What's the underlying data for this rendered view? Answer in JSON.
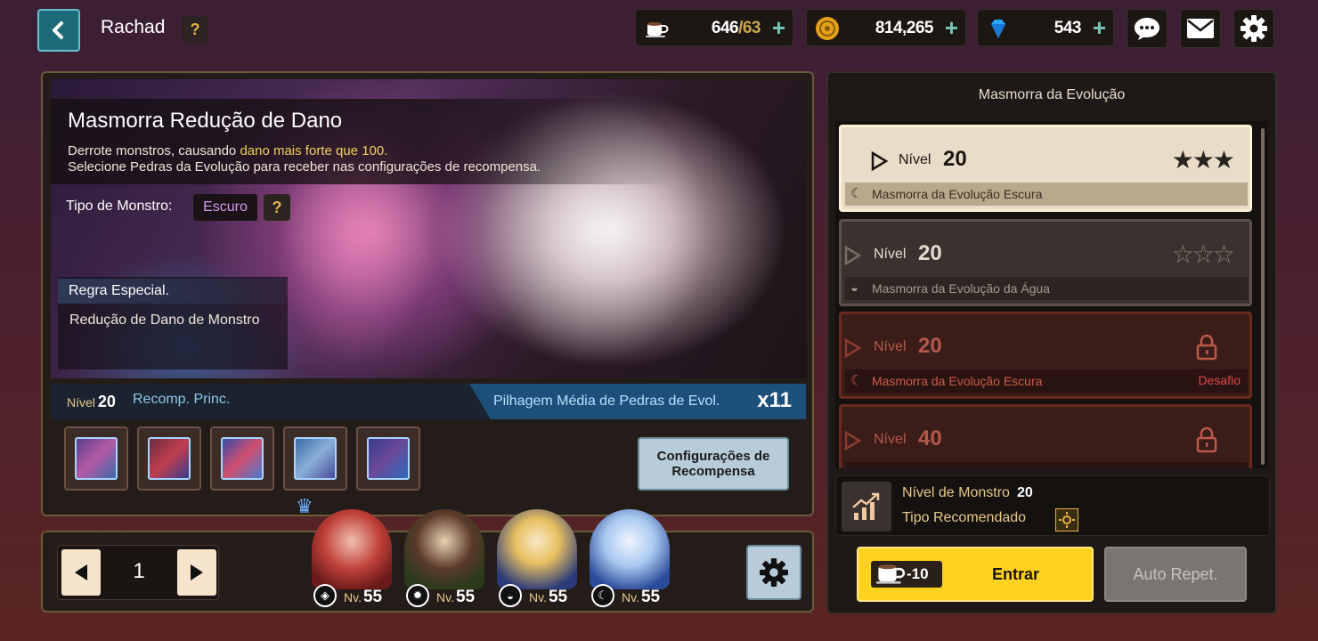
{
  "header": {
    "player_name": "Rachad",
    "help_label": "?",
    "stamina": {
      "current": "646",
      "max": "/63",
      "plus": "+"
    },
    "gold": {
      "value": "814,265",
      "plus": "+"
    },
    "gems": {
      "value": "543",
      "plus": "+"
    },
    "icons": {
      "back": "chevron-left-icon",
      "chat": "chat-icon",
      "mail": "mail-icon",
      "settings": "gear-icon"
    }
  },
  "dungeon": {
    "title": "Masmorra Redução de Dano",
    "desc_line1_pre": "Derrote monstros, causando ",
    "desc_line1_hl": "dano mais forte que 100.",
    "desc_line2": "Selecione Pedras da Evolução para receber nas configurações de recompensa.",
    "monster_type_label": "Tipo de Monstro:",
    "monster_type_value": "Escuro",
    "help_label": "?",
    "special_rule_title": "Regra Especial.",
    "special_rule_body": "Redução de Dano de Monstro"
  },
  "reward_bar": {
    "level_label": "Nível",
    "level_value": "20",
    "recomp_label": "Recomp. Princ.",
    "pillage_label": "Pilhagem Média de Pedras de Evol.",
    "pillage_value": "x11"
  },
  "reward_items": [
    "evolution-stone-1",
    "evolution-stone-2",
    "evolution-stone-3",
    "evolution-stone-4",
    "evolution-stone-5"
  ],
  "config_button": "Configurações de Recompensa",
  "party": {
    "page": "1",
    "heroes": [
      {
        "level_label": "Nv.",
        "level": "55",
        "element": "◈",
        "color": "#c0413a"
      },
      {
        "level_label": "Nv.",
        "level": "55",
        "element": "✹",
        "color": "#4a8a3a"
      },
      {
        "level_label": "Nv.",
        "level": "55",
        "element": "◒",
        "color": "#2a4a8a"
      },
      {
        "level_label": "Nv.",
        "level": "55",
        "element": "☾",
        "color": "#2a4a9a"
      }
    ]
  },
  "evolution": {
    "title": "Masmorra da Evolução",
    "levels": [
      {
        "nivel": "Nível",
        "num": "20",
        "stars": "★★★",
        "sub_icon": "☾",
        "sub": "Masmorra da Evolução Escura",
        "state": "active"
      },
      {
        "nivel": "Nível",
        "num": "20",
        "stars": "☆☆☆",
        "sub_icon": "◒",
        "sub": "Masmorra da Evolução da Água",
        "state": "normal"
      },
      {
        "nivel": "Nível",
        "num": "20",
        "sub_icon": "☾",
        "sub": "Masmorra da Evolução Escura",
        "badge": "Desafio",
        "state": "locked"
      },
      {
        "nivel": "Nível",
        "num": "40",
        "state": "locked"
      }
    ],
    "monster_level_label": "Nível de Monstro",
    "monster_level_value": "20",
    "recommended_type_label": "Tipo Recomendado",
    "enter_cost": "-10",
    "enter_label": "Entrar",
    "auto_label": "Auto Repet."
  },
  "colors": {
    "accent_yellow": "#ffd21f",
    "teal": "#1d6b78",
    "locked_red": "#b4584a"
  }
}
